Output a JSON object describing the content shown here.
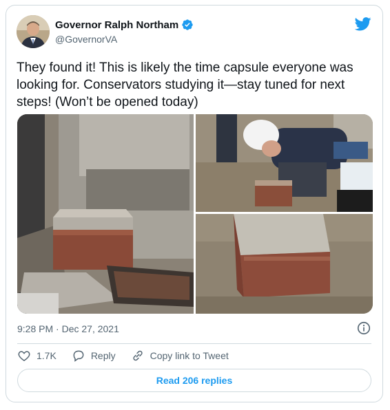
{
  "author": {
    "name": "Governor Ralph Northam",
    "handle": "@GovernorVA",
    "verified": true
  },
  "icons": {
    "brand": "twitter-bird-icon",
    "verified": "verified-badge-icon",
    "info": "info-icon",
    "like": "heart-icon",
    "reply": "reply-bubble-icon",
    "copy_link": "link-icon"
  },
  "tweet": {
    "text": "They found it! This is likely the time capsule everyone was looking for. Conservators studying it—stay tuned for next steps! (Won’t be opened today)",
    "timestamp": "9:28 PM · Dec 27, 2021"
  },
  "actions": {
    "likes": "1.7K",
    "reply_label": "Reply",
    "copy_label": "Copy link to Tweet"
  },
  "read_replies_label": "Read 206 replies",
  "colors": {
    "accent": "#1d9bf0",
    "text": "#0f1419",
    "muted": "#536471",
    "border": "#cfd9de"
  }
}
